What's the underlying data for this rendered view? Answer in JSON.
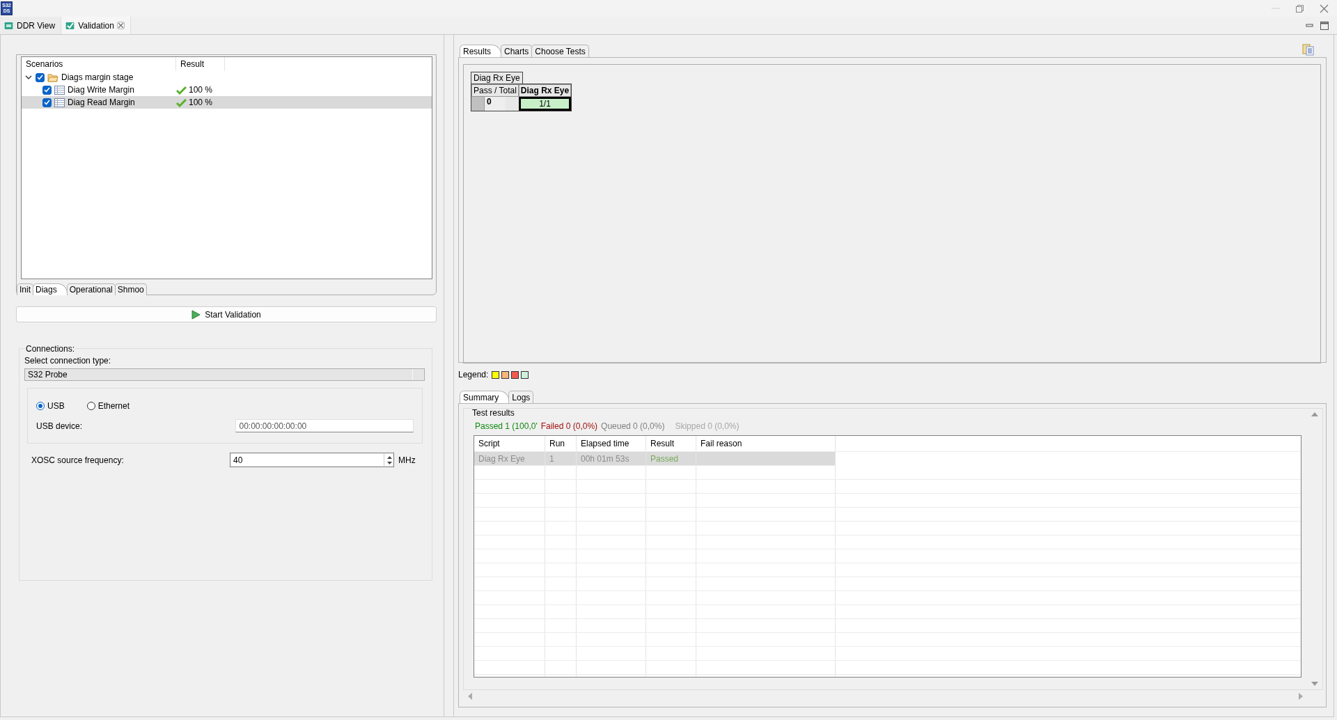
{
  "logo": {
    "lines": [
      "S32",
      "DS"
    ]
  },
  "editor_tabs": [
    {
      "label": "DDR View",
      "selected": false,
      "closable": false
    },
    {
      "label": "Validation",
      "selected": true,
      "closable": true
    }
  ],
  "scenarios": {
    "columns": [
      "Scenarios",
      "Result"
    ],
    "tree": [
      {
        "kind": "folder",
        "label": "Diags margin stage",
        "checked": true,
        "expanded": true,
        "selected": false,
        "children": [
          {
            "kind": "test",
            "label": "Diag Write Margin",
            "checked": true,
            "selected": false,
            "result": "100 %",
            "passed": true
          },
          {
            "kind": "test",
            "label": "Diag Read Margin",
            "checked": true,
            "selected": true,
            "result": "100 %",
            "passed": true
          }
        ]
      }
    ]
  },
  "stage_tabs": [
    {
      "label": "Init",
      "selected": false
    },
    {
      "label": "Diags",
      "selected": true
    },
    {
      "label": "Operational",
      "selected": false
    },
    {
      "label": "Shmoo",
      "selected": false
    }
  ],
  "start_button": {
    "label": "Start Validation"
  },
  "connections": {
    "title": "Connections:",
    "type_label": "Select connection type:",
    "type_value": "S32 Probe",
    "interfaces": [
      {
        "label": "USB",
        "selected": true
      },
      {
        "label": "Ethernet",
        "selected": false
      }
    ],
    "device_label": "USB device:",
    "device_placeholder": "00:00:00:00:00:00",
    "frequency_label": "XOSC source frequency:",
    "frequency_value": "40",
    "frequency_unit": "MHz"
  },
  "result_tabs": [
    {
      "label": "Results",
      "selected": true
    },
    {
      "label": "Charts",
      "selected": false
    },
    {
      "label": "Choose Tests",
      "selected": false
    }
  ],
  "results_grid": {
    "title": "Diag Rx Eye",
    "row_header": "Pass / Total",
    "column": "Diag Rx Eye",
    "row_value": "0",
    "cell": "1/1"
  },
  "legend": {
    "label": "Legend:",
    "swatches": [
      {
        "color": "#ffff00"
      },
      {
        "color": "#f8b57c"
      },
      {
        "color": "#f25a4e"
      },
      {
        "color": "#d0f0dc"
      }
    ]
  },
  "summary_tabs": [
    {
      "label": "Summary",
      "selected": true
    },
    {
      "label": "Logs",
      "selected": false
    }
  ],
  "test_results": {
    "title": "Test results",
    "counts": [
      {
        "kind": "passed",
        "text": "Passed 1 (100,0'"
      },
      {
        "kind": "failed",
        "text": "Failed 0 (0,0%)"
      },
      {
        "kind": "queued",
        "text": "Queued 0 (0,0%)"
      },
      {
        "kind": "skipped",
        "text": "Skipped 0 (0,0%)"
      }
    ],
    "columns": [
      "Script",
      "Run",
      "Elapsed time",
      "Result",
      "Fail reason"
    ],
    "rows": [
      {
        "cells": [
          "Diag Rx Eye",
          "1",
          "00h 01m 53s",
          "Passed"
        ],
        "selected": true
      }
    ]
  }
}
